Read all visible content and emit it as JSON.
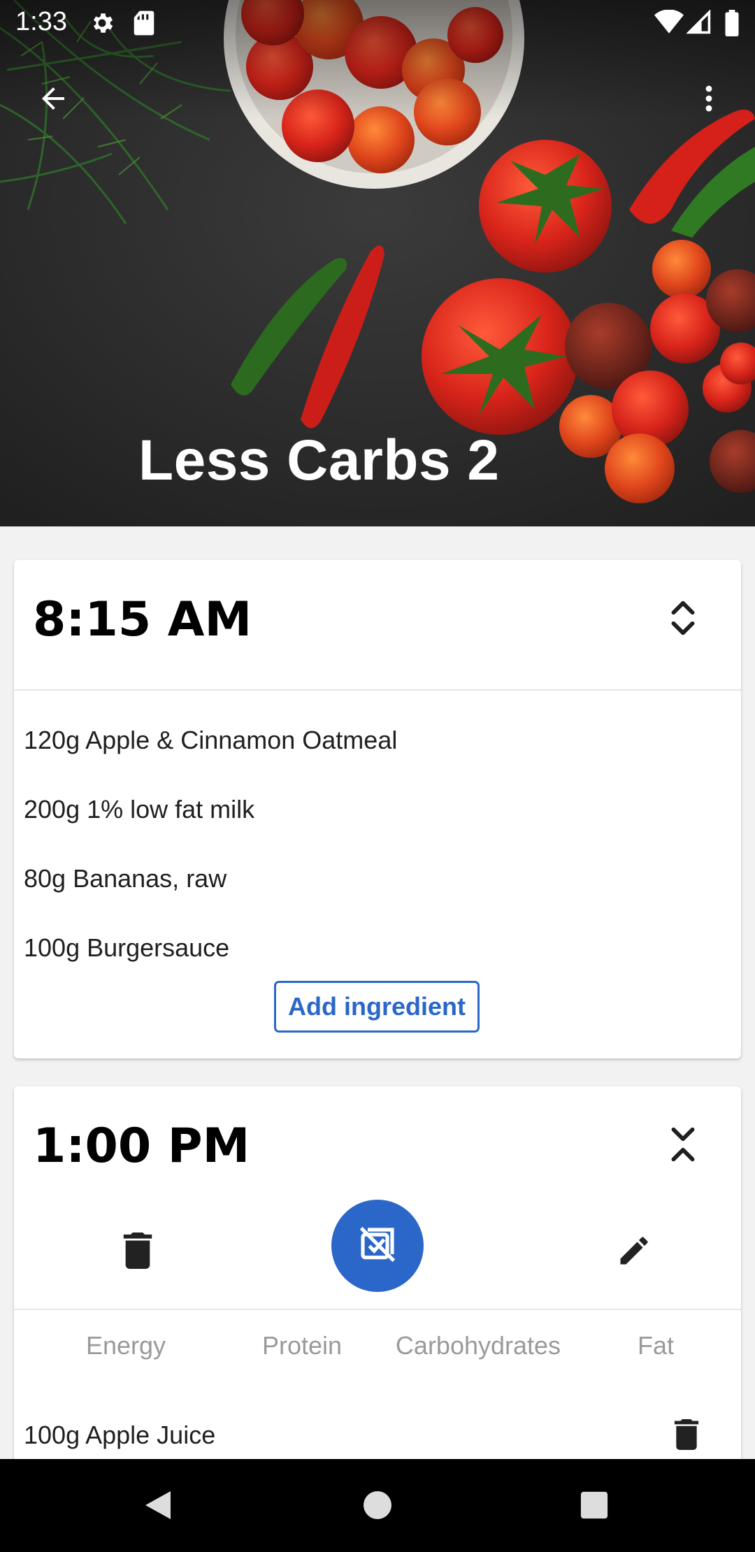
{
  "status_bar": {
    "time": "1:33"
  },
  "header": {
    "title": "Less Carbs 2"
  },
  "meals": [
    {
      "time": "8:15 AM",
      "ingredients": [
        "120g Apple & Cinnamon Oatmeal",
        "200g 1% low fat milk",
        "80g Bananas, raw",
        "100g Burgersauce"
      ],
      "add_label": "Add ingredient"
    },
    {
      "time": "1:00 PM",
      "nutrients": [
        "Energy",
        "Protein",
        "Carbohydrates",
        "Fat"
      ],
      "items": [
        "100g Apple Juice"
      ]
    }
  ],
  "colors": {
    "accent": "#2a67c9",
    "card": "#ffffff",
    "background": "#f2f2f2"
  }
}
